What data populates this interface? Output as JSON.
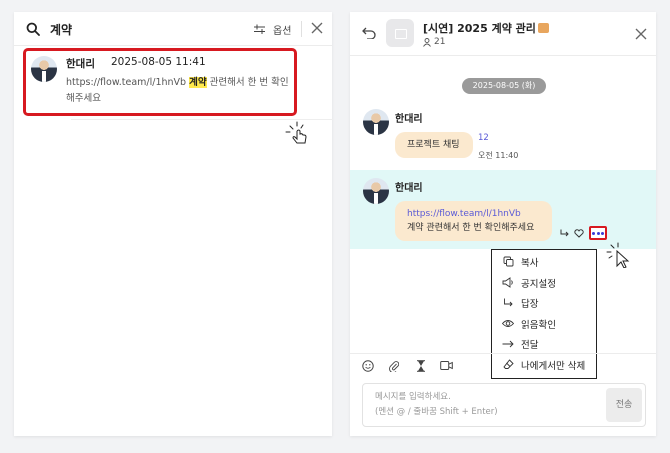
{
  "search": {
    "query": "계약",
    "options_label": "옵션",
    "result": {
      "sender": "한대리",
      "timestamp": "2025-08-05 11:41",
      "text_before": "https://flow.team/l/1hnVb ",
      "highlight": "계약",
      "text_after": " 관련해서 한 번 확인해주세요"
    }
  },
  "chat": {
    "room_title": "[시연] 2025 계약 관리",
    "member_count": "21",
    "date_divider": "2025-08-05 (화)",
    "messages": [
      {
        "sender": "한대리",
        "text": "프로젝트 채팅",
        "unread": "12",
        "time": "오전 11:40"
      },
      {
        "sender": "한대리",
        "link": "https://flow.team/l/1hnVb",
        "text": "계약 관련해서 한 번 확인해주세요"
      }
    ],
    "context_menu": [
      {
        "label": "복사",
        "icon": "copy-icon"
      },
      {
        "label": "공지설정",
        "icon": "megaphone-icon"
      },
      {
        "label": "답장",
        "icon": "reply-icon"
      },
      {
        "label": "읽음확인",
        "icon": "eye-icon"
      },
      {
        "label": "전달",
        "icon": "forward-arrow-icon"
      },
      {
        "label": "나에게서만 삭제",
        "icon": "eraser-icon"
      }
    ],
    "composer": {
      "placeholder": "메시지를 입력하세요.\n(멘션 @ / 줄바꿈 Shift + Enter)",
      "send_label": "전송"
    }
  }
}
